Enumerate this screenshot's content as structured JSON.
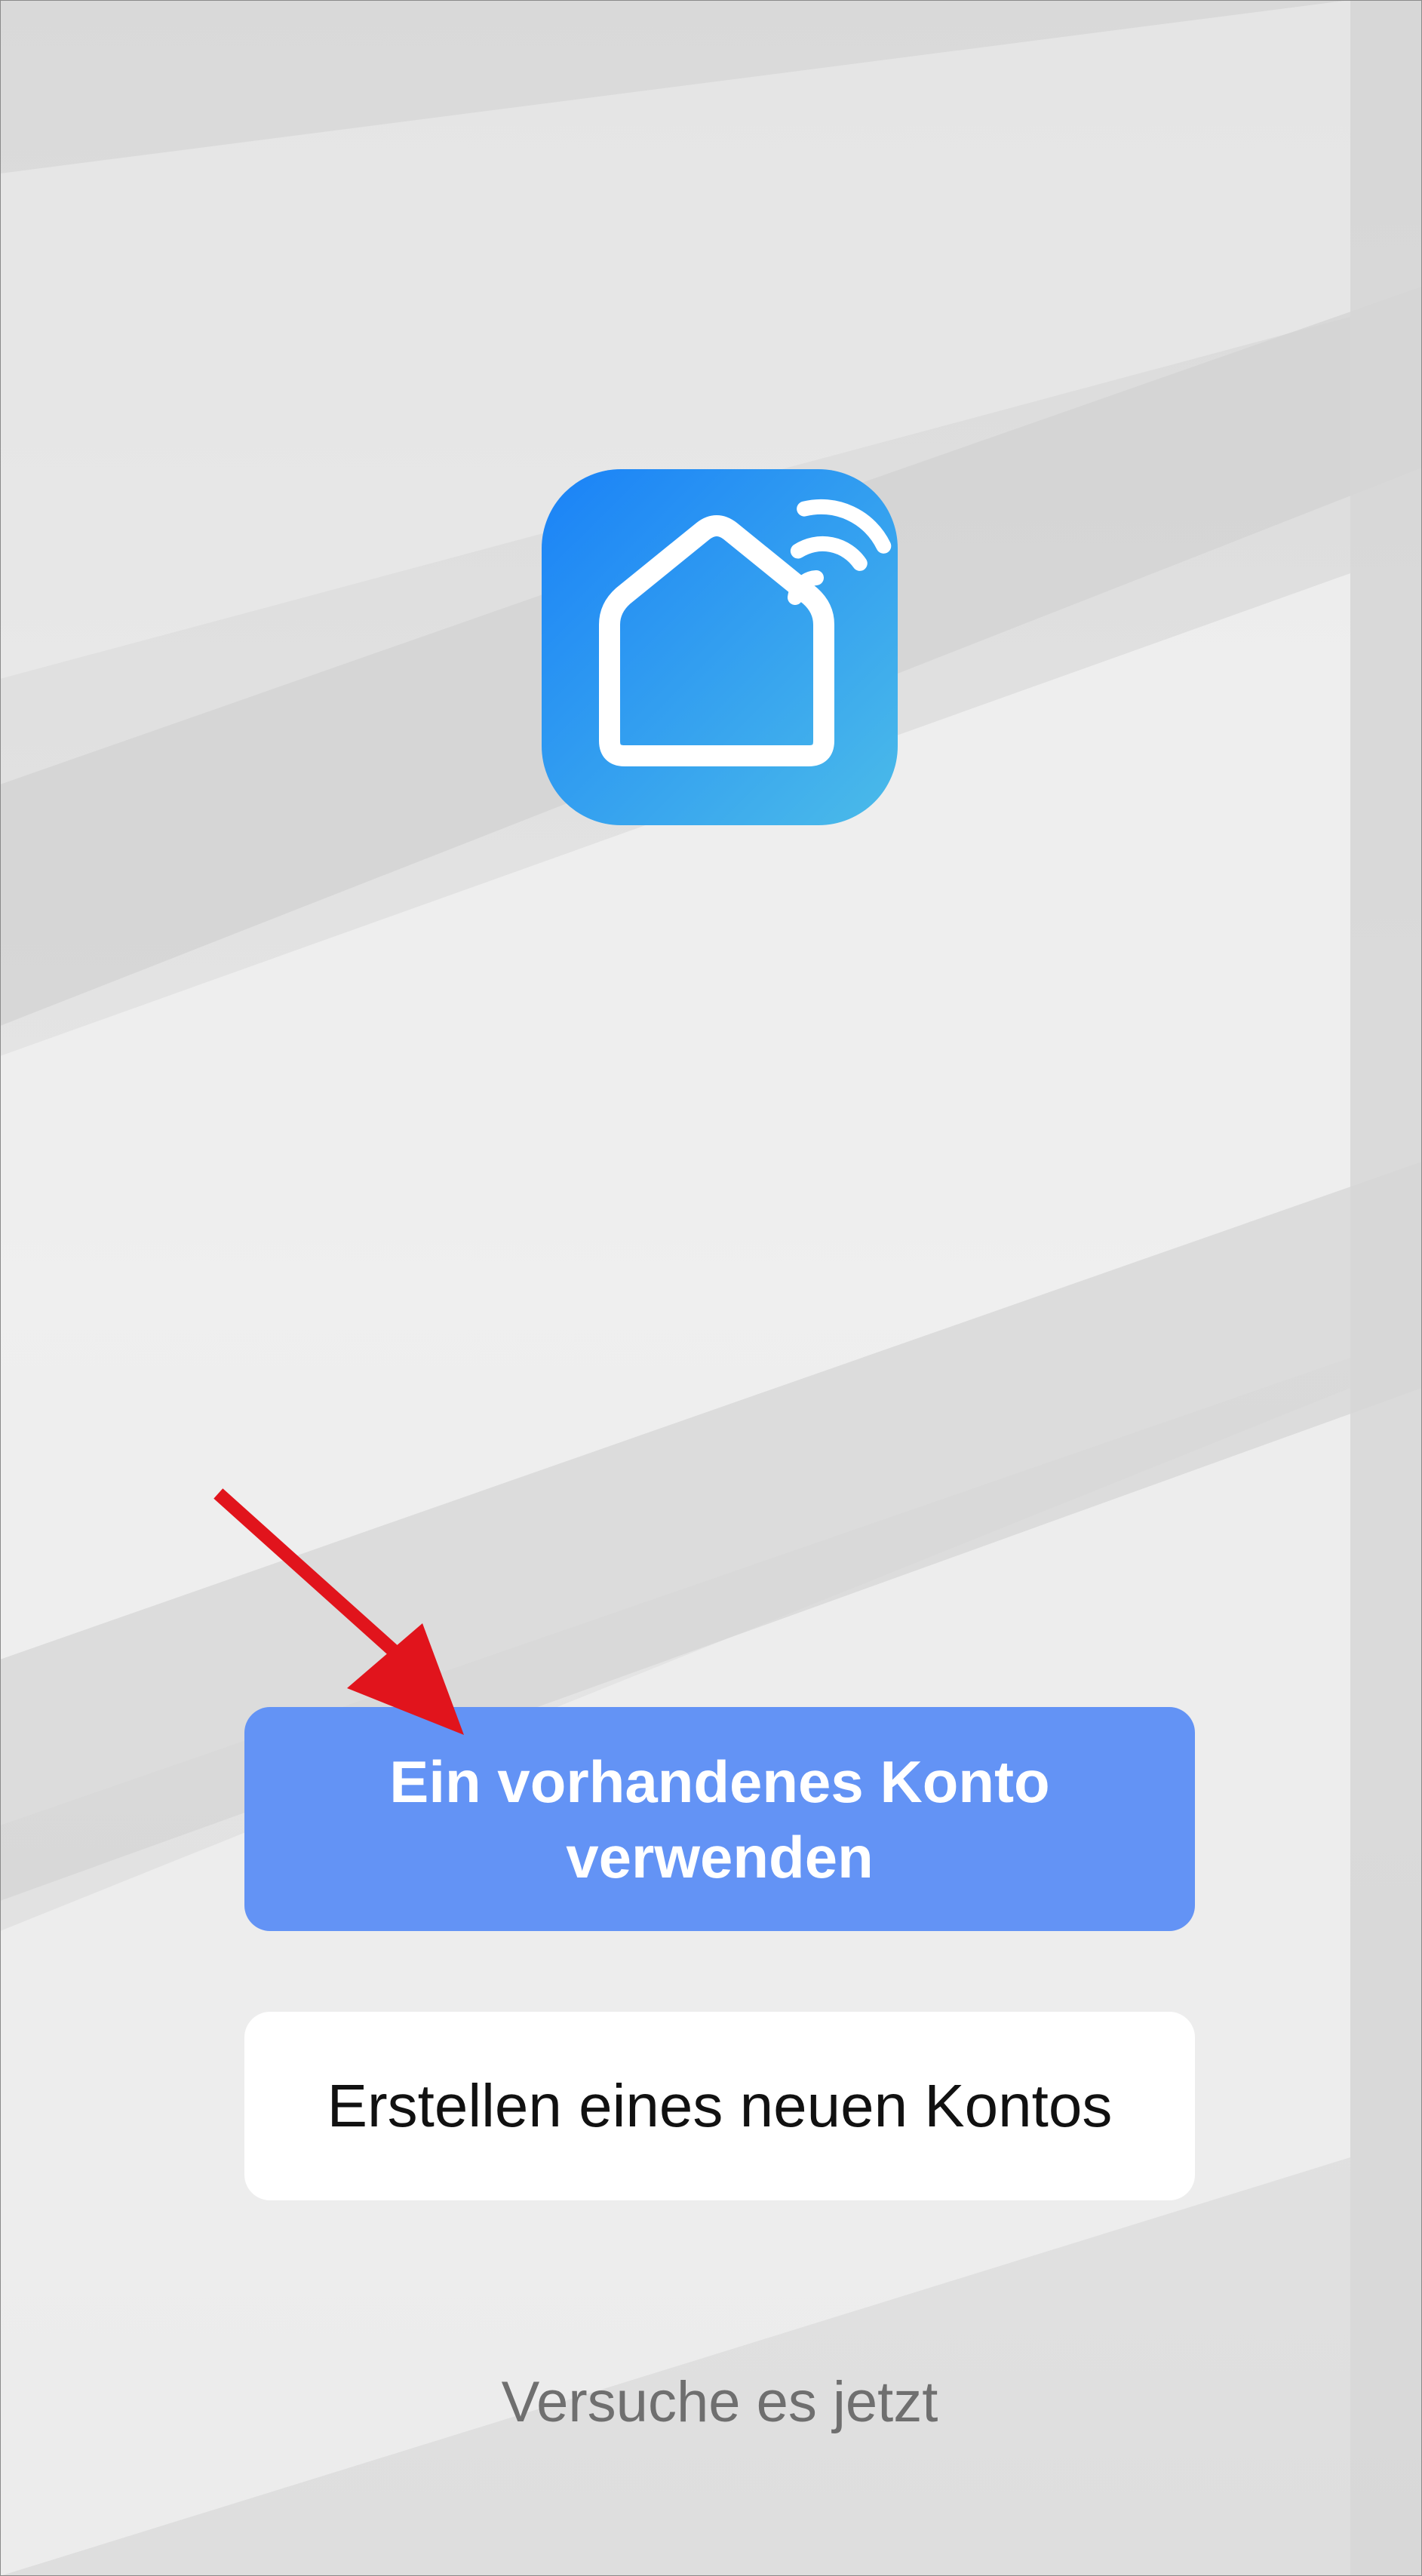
{
  "buttons": {
    "login_label": "Ein vorhandenes Konto verwenden",
    "register_label": "Erstellen eines neuen Kontos"
  },
  "links": {
    "try_label": "Versuche es jetzt"
  },
  "icons": {
    "app_logo": "smart-home-house-wifi-icon",
    "annotation": "red-arrow-pointer"
  },
  "colors": {
    "primary_button": "#6393f5",
    "secondary_button": "#ffffff",
    "logo_gradient_start": "#1a82f7",
    "logo_gradient_end": "#4bbbe9",
    "arrow": "#e1141c",
    "background": "#e3e3e3",
    "link_text": "#6f6f6f"
  }
}
